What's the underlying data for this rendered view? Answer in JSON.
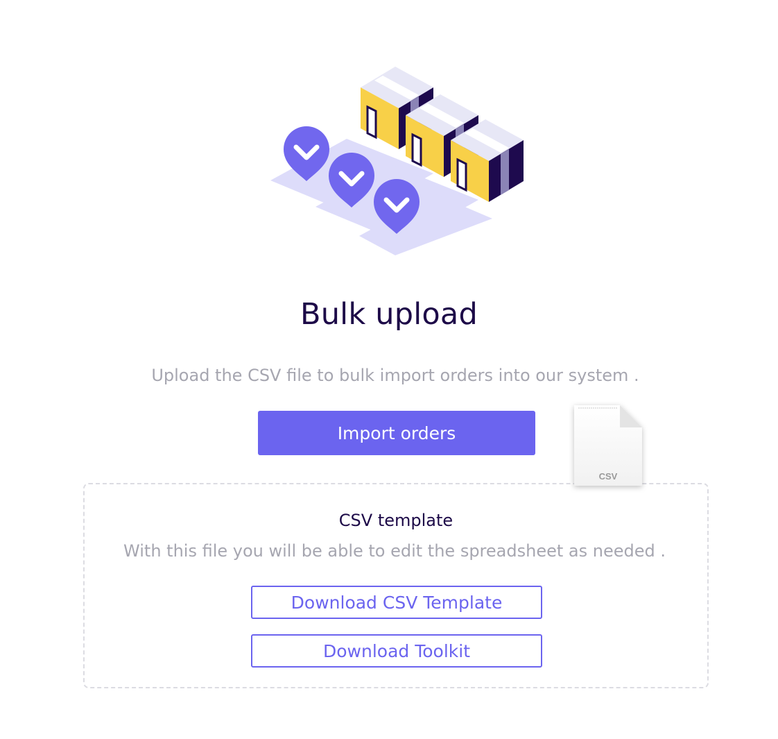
{
  "title": "Bulk upload",
  "subtitle": "Upload the CSV file to bulk import orders into our system .",
  "import_button": "Import orders",
  "csv_file_label": "CSV",
  "template": {
    "title": "CSV template",
    "description": "With this file you will be able to edit the spreadsheet as needed .",
    "download_template_label": "Download CSV Template",
    "download_toolkit_label": "Download Toolkit"
  },
  "colors": {
    "primary": "#6b64ef",
    "heading": "#1d0a48",
    "muted_text": "#a6a6b0",
    "box_yellow": "#f8d048",
    "box_dark": "#1e0a4e",
    "pin_purple": "#7167ee",
    "lane_lavender": "#dddcfa"
  },
  "icons": {
    "illustration": "bulk-delivery-illustration",
    "file": "csv-file-icon"
  }
}
